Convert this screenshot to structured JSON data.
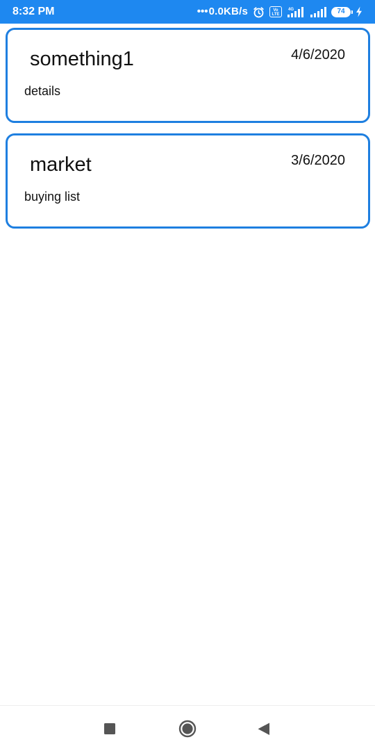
{
  "status_bar": {
    "time": "8:32 PM",
    "net_dots": "•••",
    "net_speed": "0.0KB/s",
    "volte_label": "Vo LTE",
    "network_type": "4G",
    "battery_level": "74",
    "background_color": "#1e88f0",
    "icons": [
      "alarm-icon",
      "volte-icon",
      "signal-4g-icon",
      "signal-icon",
      "battery-icon",
      "charging-icon"
    ]
  },
  "notes": [
    {
      "title": "something1",
      "date": "4/6/2020",
      "detail": "details"
    },
    {
      "title": "market",
      "date": "3/6/2020",
      "detail": "buying list"
    }
  ],
  "card_border_color": "#1e7fe0",
  "nav_bar": {
    "buttons": [
      "recents-icon",
      "home-icon",
      "back-icon"
    ]
  }
}
